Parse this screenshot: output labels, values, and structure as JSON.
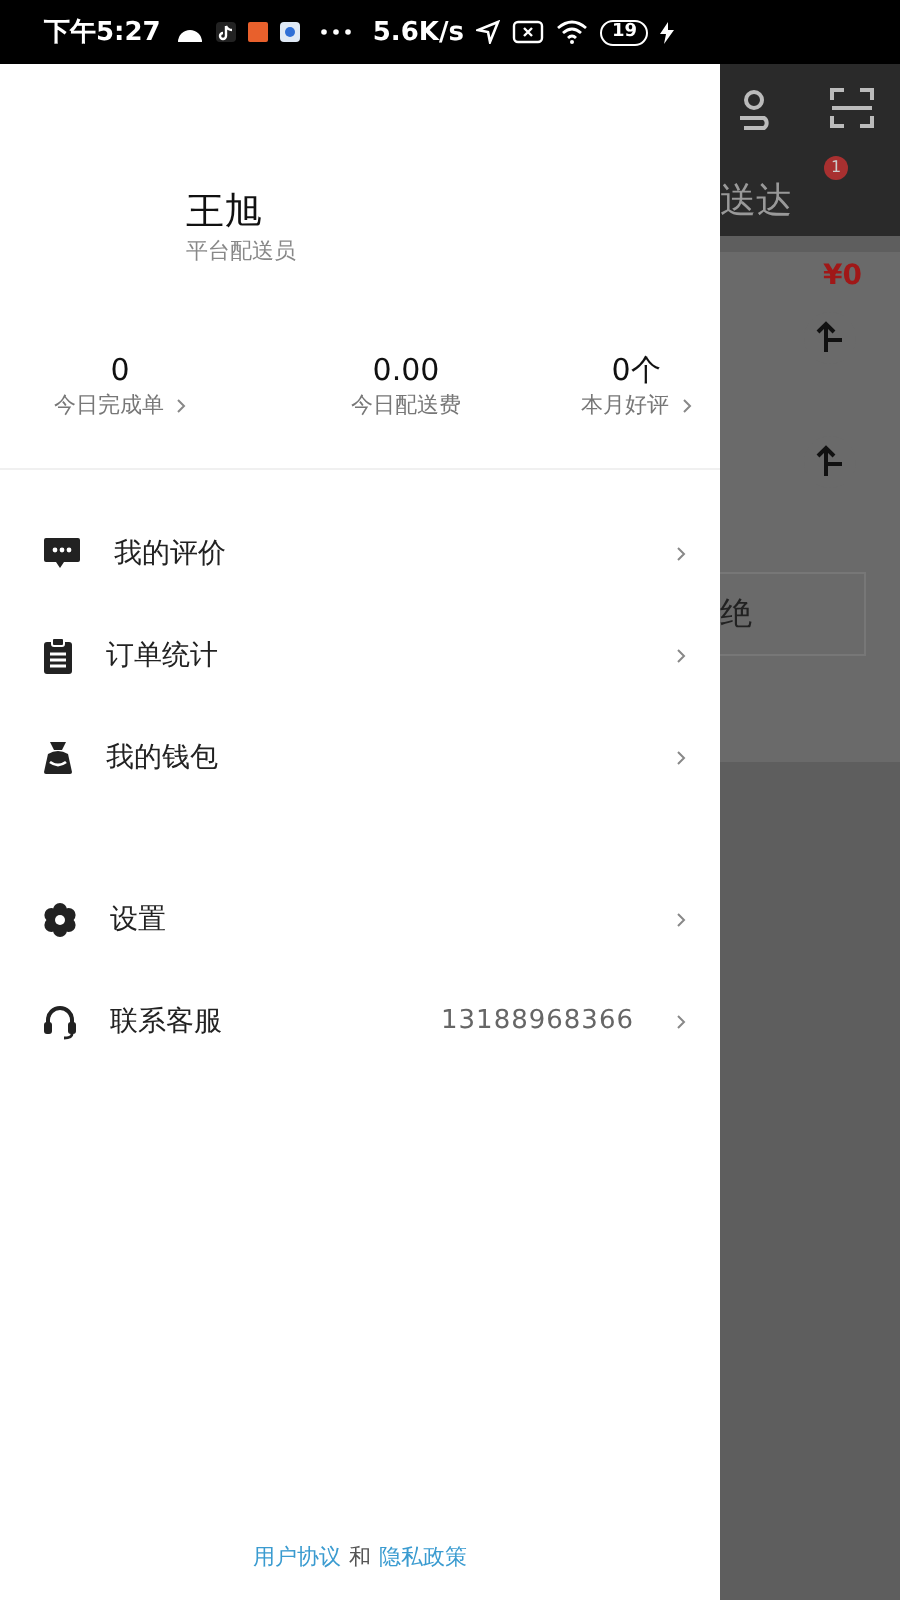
{
  "status_bar": {
    "time": "下午5:27",
    "speed": "5.6K/s",
    "battery": "19"
  },
  "profile": {
    "name": "王旭",
    "role": "平台配送员"
  },
  "stats": [
    {
      "value": "0",
      "label": "今日完成单",
      "chevron": true
    },
    {
      "value": "0.00",
      "label": "今日配送费",
      "chevron": false
    },
    {
      "value": "0个",
      "label": "本月好评",
      "chevron": true
    }
  ],
  "menu_groups": [
    [
      {
        "label": "我的评价"
      },
      {
        "label": "订单统计"
      },
      {
        "label": "我的钱包"
      }
    ],
    [
      {
        "label": "设置"
      },
      {
        "label": "联系客服",
        "value": "13188968366"
      }
    ]
  ],
  "footer": {
    "link_1": "用户协议",
    "joiner": "和",
    "link_2": "隐私政策"
  },
  "background_app": {
    "tab": "送达",
    "badge": "1",
    "amount": "¥0",
    "button": "绝"
  }
}
